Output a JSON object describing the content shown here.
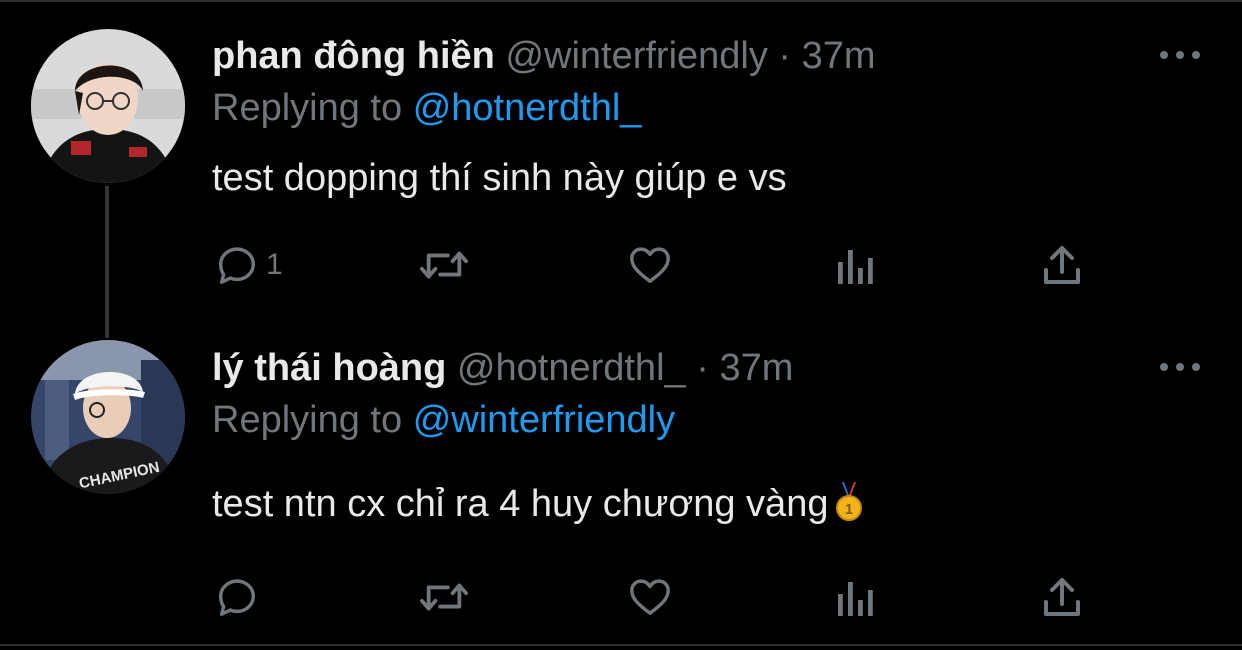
{
  "thread": [
    {
      "author_name": "phan đông hiền",
      "handle": "@winterfriendly",
      "separator": "·",
      "time": "37m",
      "replying_prefix": "Replying to",
      "replying_to": "@hotnerdthl_",
      "text": "test dopping thí sinh này giúp e vs",
      "reply_count": "1",
      "avatar_icon": "avatar-photo"
    },
    {
      "author_name": "lý thái hoàng",
      "handle": "@hotnerdthl_",
      "separator": "·",
      "time": "37m",
      "replying_prefix": "Replying to",
      "replying_to": "@winterfriendly",
      "text": "test ntn cx chỉ ra 4 huy chương vàng",
      "emoji_icon": "gold-medal-icon",
      "reply_count": "",
      "avatar_icon": "avatar-photo"
    }
  ],
  "colors": {
    "background": "#000000",
    "primary_text": "#e7e9ea",
    "secondary_text": "#71767b",
    "accent": "#1d9bf0"
  }
}
